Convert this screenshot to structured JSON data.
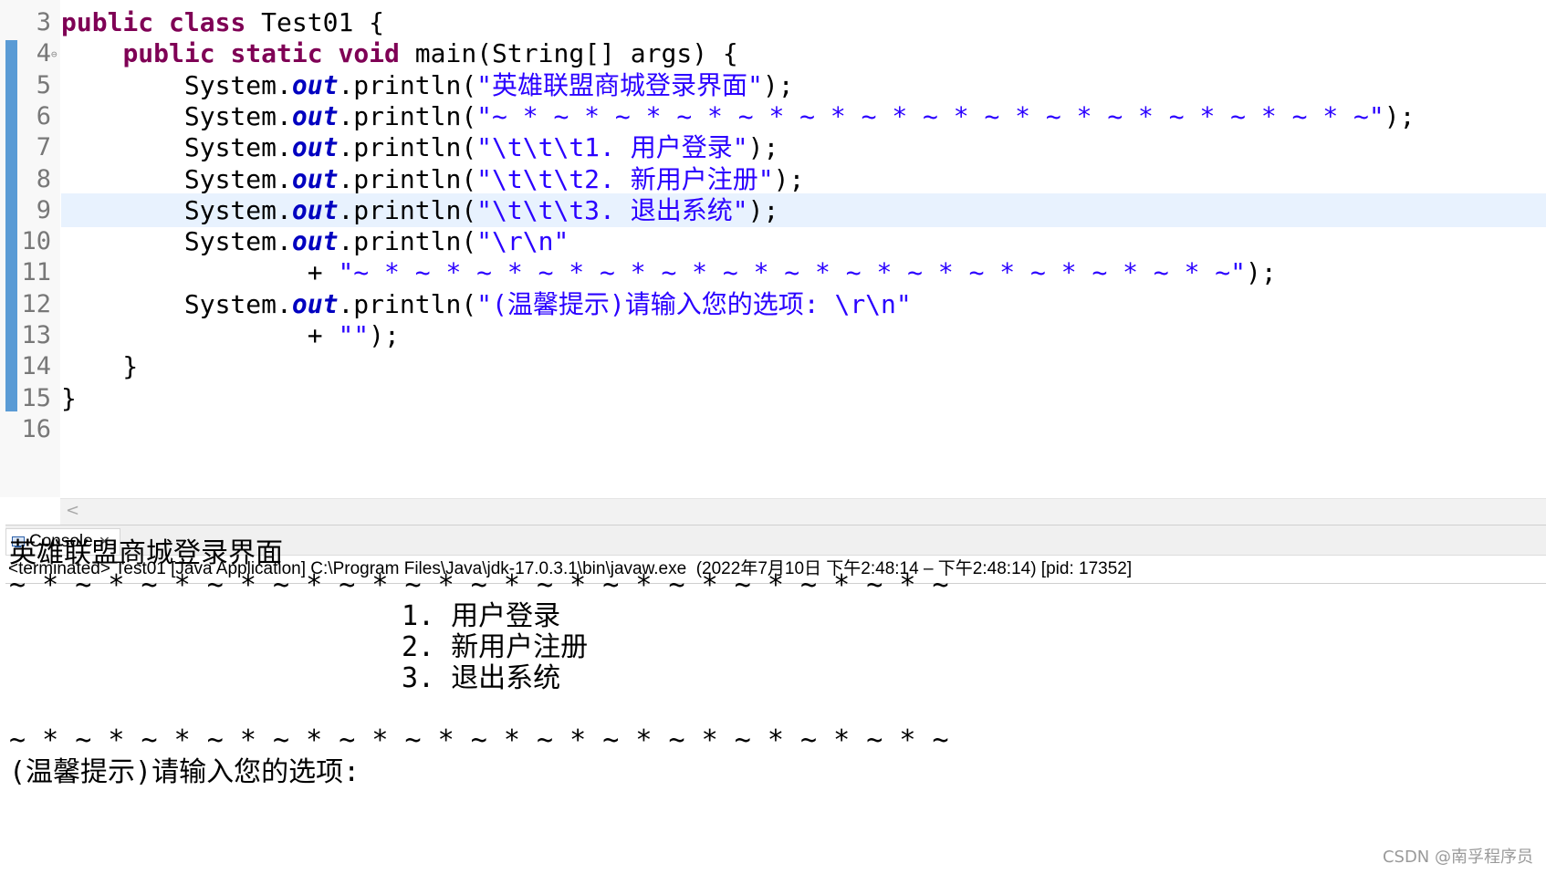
{
  "editor": {
    "lines": [
      {
        "num": "3",
        "tokens": [
          {
            "t": "kw",
            "v": "public"
          },
          {
            "t": "p",
            "v": " "
          },
          {
            "t": "kw",
            "v": "class"
          },
          {
            "t": "p",
            "v": " Test01 {"
          }
        ]
      },
      {
        "num": "4",
        "fold": true,
        "tokens": [
          {
            "t": "p",
            "v": "    "
          },
          {
            "t": "kw",
            "v": "public"
          },
          {
            "t": "p",
            "v": " "
          },
          {
            "t": "kw",
            "v": "static"
          },
          {
            "t": "p",
            "v": " "
          },
          {
            "t": "kw",
            "v": "void"
          },
          {
            "t": "p",
            "v": " main(String[] args) {"
          }
        ]
      },
      {
        "num": "5",
        "tokens": [
          {
            "t": "p",
            "v": "        System."
          },
          {
            "t": "fld",
            "v": "out"
          },
          {
            "t": "p",
            "v": ".println("
          },
          {
            "t": "str",
            "v": "\"英雄联盟商城登录界面\""
          },
          {
            "t": "p",
            "v": ");"
          }
        ]
      },
      {
        "num": "6",
        "tokens": [
          {
            "t": "p",
            "v": "        System."
          },
          {
            "t": "fld",
            "v": "out"
          },
          {
            "t": "p",
            "v": ".println("
          },
          {
            "t": "str",
            "v": "\"~ * ~ * ~ * ~ * ~ * ~ * ~ * ~ * ~ * ~ * ~ * ~ * ~ * ~ * ~\""
          },
          {
            "t": "p",
            "v": ");"
          }
        ]
      },
      {
        "num": "7",
        "tokens": [
          {
            "t": "p",
            "v": "        System."
          },
          {
            "t": "fld",
            "v": "out"
          },
          {
            "t": "p",
            "v": ".println("
          },
          {
            "t": "str",
            "v": "\"\\t\\t\\t1. 用户登录\""
          },
          {
            "t": "p",
            "v": ");"
          }
        ]
      },
      {
        "num": "8",
        "tokens": [
          {
            "t": "p",
            "v": "        System."
          },
          {
            "t": "fld",
            "v": "out"
          },
          {
            "t": "p",
            "v": ".println("
          },
          {
            "t": "str",
            "v": "\"\\t\\t\\t2. 新用户注册\""
          },
          {
            "t": "p",
            "v": ");"
          }
        ]
      },
      {
        "num": "9",
        "current": true,
        "tokens": [
          {
            "t": "p",
            "v": "        System."
          },
          {
            "t": "fld",
            "v": "out"
          },
          {
            "t": "p",
            "v": ".println("
          },
          {
            "t": "str",
            "v": "\"\\t\\t\\t3. 退出系统\""
          },
          {
            "t": "p",
            "v": ");"
          }
        ]
      },
      {
        "num": "10",
        "tokens": [
          {
            "t": "p",
            "v": "        System."
          },
          {
            "t": "fld",
            "v": "out"
          },
          {
            "t": "p",
            "v": ".println("
          },
          {
            "t": "str",
            "v": "\"\\r\\n\""
          }
        ]
      },
      {
        "num": "11",
        "tokens": [
          {
            "t": "p",
            "v": "                + "
          },
          {
            "t": "str",
            "v": "\"~ * ~ * ~ * ~ * ~ * ~ * ~ * ~ * ~ * ~ * ~ * ~ * ~ * ~ * ~\""
          },
          {
            "t": "p",
            "v": ");"
          }
        ]
      },
      {
        "num": "12",
        "tokens": [
          {
            "t": "p",
            "v": "        System."
          },
          {
            "t": "fld",
            "v": "out"
          },
          {
            "t": "p",
            "v": ".println("
          },
          {
            "t": "str",
            "v": "\"(温馨提示)请输入您的选项: \\r\\n\""
          }
        ]
      },
      {
        "num": "13",
        "tokens": [
          {
            "t": "p",
            "v": "                + "
          },
          {
            "t": "str",
            "v": "\"\""
          },
          {
            "t": "p",
            "v": ");"
          }
        ]
      },
      {
        "num": "14",
        "tokens": [
          {
            "t": "p",
            "v": "    }"
          }
        ]
      },
      {
        "num": "15",
        "tokens": [
          {
            "t": "p",
            "v": "}"
          }
        ]
      },
      {
        "num": "16",
        "tokens": []
      }
    ],
    "scroll_left_icon": "chevron-left-icon"
  },
  "console": {
    "tab_label": "Console",
    "tab_icon": "console-icon",
    "close_glyph": "✕",
    "status": "<terminated> Test01 [Java Application] C:\\Program Files\\Java\\jdk-17.0.3.1\\bin\\javaw.exe  (2022年7月10日 下午2:48:14 – 下午2:48:14) [pid: 17352]",
    "output": {
      "title": "英雄联盟商城登录界面",
      "divider_top": "~ * ~ * ~ * ~ * ~ * ~ * ~ * ~ * ~ * ~ * ~ * ~ * ~ * ~ * ~",
      "menu": [
        "1. 用户登录",
        "2. 新用户注册",
        "3. 退出系统"
      ],
      "divider_bottom": "~ * ~ * ~ * ~ * ~ * ~ * ~ * ~ * ~ * ~ * ~ * ~ * ~ * ~ * ~",
      "prompt": "(温馨提示)请输入您的选项:"
    }
  },
  "watermark": "CSDN @南孚程序员",
  "colors": {
    "keyword": "#7f0055",
    "field": "#0000c0",
    "string": "#2a00ff",
    "current_line": "#e8f2fe",
    "change_bar": "#5a9bd5"
  }
}
